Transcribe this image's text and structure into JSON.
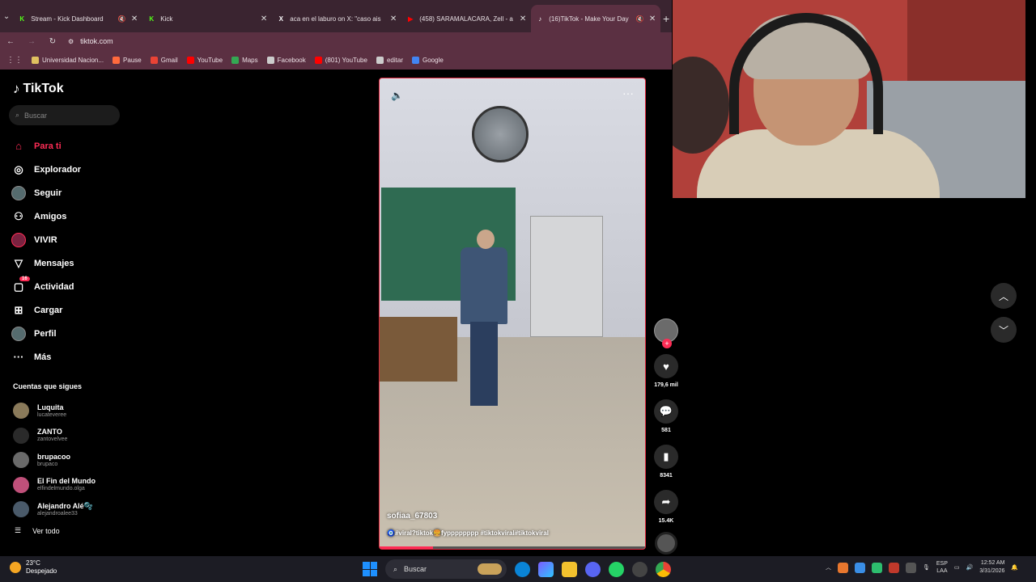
{
  "browser": {
    "tabs": [
      {
        "title": "Stream - Kick Dashboard",
        "color": "#53fc18",
        "glyph": "K"
      },
      {
        "title": "Kick",
        "color": "#53fc18",
        "glyph": "K"
      },
      {
        "title": "aca en el laburo on X: \"caso ais",
        "color": "#ffffff",
        "glyph": "X"
      },
      {
        "title": "(458) SARAMALACARA, Zell - a",
        "color": "#ff0000",
        "glyph": "▶"
      },
      {
        "title": "(16)TikTok - Make Your Day",
        "color": "#ffffff",
        "glyph": "♪"
      }
    ],
    "url": "tiktok.com",
    "bookmarks": [
      {
        "label": "Universidad Nacion...",
        "color": "#e0c060"
      },
      {
        "label": "Pause",
        "color": "#ff6a3d"
      },
      {
        "label": "Gmail",
        "color": "#ea4335"
      },
      {
        "label": "YouTube",
        "color": "#ff0000"
      },
      {
        "label": "Maps",
        "color": "#34a853"
      },
      {
        "label": "Facebook",
        "color": "#cccccc"
      },
      {
        "label": "(801) YouTube",
        "color": "#ff0000"
      },
      {
        "label": "editar",
        "color": "#cccccc"
      },
      {
        "label": "Google",
        "color": "#4285f4"
      }
    ]
  },
  "tiktok": {
    "logo": "TikTok",
    "search_placeholder": "Buscar",
    "nav": [
      {
        "label": "Para ti",
        "icon": "home-icon",
        "glyph": "⌂",
        "active": true
      },
      {
        "label": "Explorador",
        "icon": "compass-icon",
        "glyph": "◎"
      },
      {
        "label": "Seguir",
        "icon": "avatar-icon",
        "glyph": ""
      },
      {
        "label": "Amigos",
        "icon": "friends-icon",
        "glyph": "⚇"
      },
      {
        "label": "VIVIR",
        "icon": "live-icon",
        "glyph": ""
      },
      {
        "label": "Mensajes",
        "icon": "send-icon",
        "glyph": "▽"
      },
      {
        "label": "Actividad",
        "icon": "inbox-icon",
        "glyph": "▢",
        "badge": "16"
      },
      {
        "label": "Cargar",
        "icon": "upload-icon",
        "glyph": "⊞"
      },
      {
        "label": "Perfil",
        "icon": "profile-icon",
        "glyph": ""
      },
      {
        "label": "Más",
        "icon": "more-icon",
        "glyph": "···"
      }
    ],
    "following_title": "Cuentas que sigues",
    "following": [
      {
        "name": "Luquita",
        "handle": "lucateveree",
        "color": "#8a7a5a"
      },
      {
        "name": "ZANTO",
        "handle": "zantovelvee",
        "color": "#2a2a2a"
      },
      {
        "name": "brupacoo",
        "handle": "brupaco",
        "color": "#6a6a6a"
      },
      {
        "name": "El Fin del Mundo",
        "handle": "elfindelmundo.olga",
        "color": "#c0507a"
      },
      {
        "name": "Alejandro Alé🫧",
        "handle": "alejandroalee33",
        "color": "#4a5a6a"
      }
    ],
    "see_all": "Ver todo",
    "video": {
      "author": "sofiaa_67803",
      "caption": "🧿#viral?tiktok🍔fypppppppp #tiktokviral#tiktokviral",
      "progress": 0.2
    },
    "actions": {
      "likes": "179,6 mil",
      "comments": "581",
      "saves": "8341",
      "shares": "15.4K"
    }
  },
  "taskbar": {
    "temp": "23°C",
    "weather": "Despejado",
    "search": "Buscar",
    "lang_top": "ESP",
    "lang_bottom": "LAA",
    "time": "12:52 AM",
    "date": "3/31/2026"
  }
}
